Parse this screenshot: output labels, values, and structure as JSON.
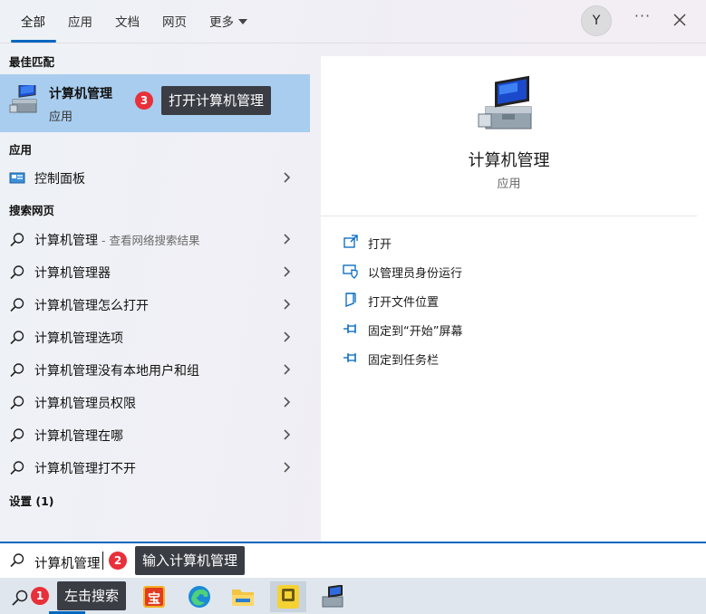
{
  "tabs": [
    {
      "label": "全部"
    },
    {
      "label": "应用"
    },
    {
      "label": "文档"
    },
    {
      "label": "网页"
    },
    {
      "label": "更多"
    }
  ],
  "account": {
    "initial": "Y"
  },
  "header": {
    "more_glyph": "···"
  },
  "sections": {
    "best_match": "最佳匹配",
    "apps": "应用",
    "web": "搜索网页",
    "settings": "设置 (1)"
  },
  "best_match": {
    "title": "计算机管理",
    "subtitle": "应用"
  },
  "apps": [
    {
      "label": "控制面板"
    }
  ],
  "web_results": [
    {
      "label": "计算机管理",
      "hint": " - 查看网络搜索结果"
    },
    {
      "label": "计算机管理器",
      "hint": ""
    },
    {
      "label": "计算机管理怎么打开",
      "hint": ""
    },
    {
      "label": "计算机管理选项",
      "hint": ""
    },
    {
      "label": "计算机管理没有本地用户和组",
      "hint": ""
    },
    {
      "label": "计算机管理员权限",
      "hint": ""
    },
    {
      "label": "计算机管理在哪",
      "hint": ""
    },
    {
      "label": "计算机管理打不开",
      "hint": ""
    }
  ],
  "detail": {
    "title": "计算机管理",
    "subtitle": "应用",
    "actions": [
      {
        "label": "打开",
        "icon": "open-icon"
      },
      {
        "label": "以管理员身份运行",
        "icon": "shield-icon"
      },
      {
        "label": "打开文件位置",
        "icon": "file-location-icon"
      },
      {
        "label": "固定到“开始”屏幕",
        "icon": "pin-icon"
      },
      {
        "label": "固定到任务栏",
        "icon": "pin-icon"
      }
    ]
  },
  "search": {
    "value": "计算机管理"
  },
  "annotations": [
    {
      "number": "1",
      "text": "左击搜索"
    },
    {
      "number": "2",
      "text": "输入计算机管理"
    },
    {
      "number": "3",
      "text": "打开计算机管理"
    }
  ],
  "taskbar": {
    "apps": [
      "search-icon",
      "treasure-app-icon",
      "edge-icon",
      "file-explorer-icon",
      "yellow-app-icon",
      "computer-management-icon"
    ],
    "treasure_label": "宝"
  },
  "colors": {
    "accent": "#0067c0",
    "selected": "#a9cdee",
    "badge": "#e8303a",
    "callout": "#3a3d44"
  }
}
